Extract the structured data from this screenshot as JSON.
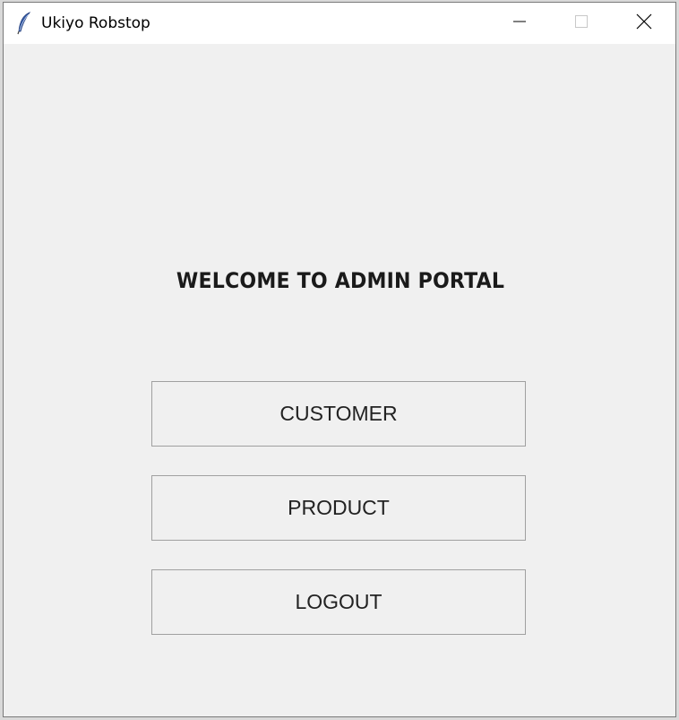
{
  "window": {
    "title": "Ukiyo Robstop",
    "app_icon": "feather-icon",
    "controls": {
      "minimize_icon": "minimize-icon",
      "maximize_icon": "maximize-icon",
      "close_icon": "close-icon"
    }
  },
  "main": {
    "heading": "WELCOME TO ADMIN PORTAL",
    "buttons": {
      "customer": "CUSTOMER",
      "product": "PRODUCT",
      "logout": "LOGOUT"
    }
  }
}
